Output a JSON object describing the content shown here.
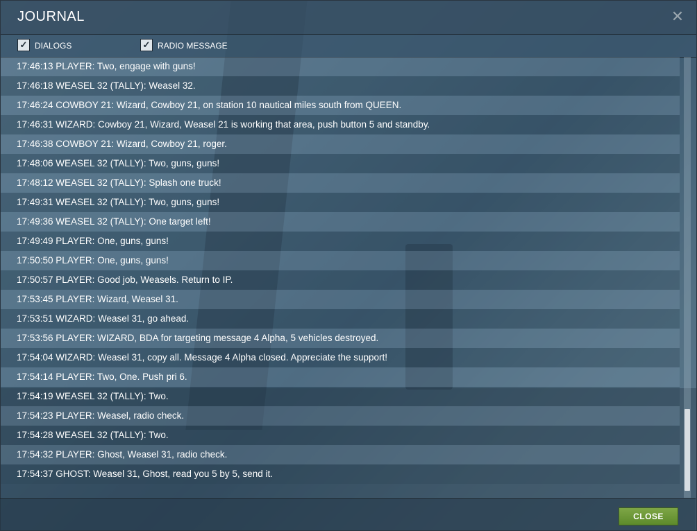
{
  "window": {
    "title": "JOURNAL"
  },
  "filters": [
    {
      "label": "DIALOGS",
      "checked": true
    },
    {
      "label": "RADIO MESSAGE",
      "checked": true
    }
  ],
  "messages": [
    "17:46:13 PLAYER: Two, engage with guns!",
    "17:46:18 WEASEL 32 (TALLY): Weasel 32.",
    "17:46:24 COWBOY 21: Wizard, Cowboy 21, on station 10 nautical miles south from QUEEN.",
    "17:46:31 WIZARD: Cowboy 21, Wizard, Weasel 21 is working that area, push button 5 and standby.",
    "17:46:38 COWBOY 21: Wizard, Cowboy 21, roger.",
    "17:48:06 WEASEL 32 (TALLY): Two, guns, guns!",
    "17:48:12 WEASEL 32 (TALLY): Splash one truck!",
    "17:49:31 WEASEL 32 (TALLY): Two, guns, guns!",
    "17:49:36 WEASEL 32 (TALLY): One target left!",
    "17:49:49 PLAYER: One, guns, guns!",
    "17:50:50 PLAYER: One, guns, guns!",
    "17:50:57 PLAYER: Good job, Weasels. Return to IP.",
    "17:53:45 PLAYER: Wizard, Weasel 31.",
    "17:53:51 WIZARD: Weasel 31, go ahead.",
    "17:53:56 PLAYER: WIZARD, BDA for targeting message 4 Alpha, 5 vehicles destroyed.",
    "17:54:04 WIZARD: Weasel 31, copy all. Message 4 Alpha closed. Appreciate the support!",
    "17:54:14 PLAYER: Two, One. Push pri 6.",
    "17:54:19 WEASEL 32 (TALLY): Two.",
    "17:54:23 PLAYER: Weasel, radio check.",
    "17:54:28 WEASEL 32 (TALLY): Two.",
    "17:54:32 PLAYER: Ghost, Weasel 31, radio check.",
    "17:54:37 GHOST: Weasel 31, Ghost, read you 5 by 5, send it."
  ],
  "footer": {
    "close_label": "CLOSE"
  },
  "colors": {
    "accent_green": "#6a9a35",
    "text": "#ffffff"
  }
}
